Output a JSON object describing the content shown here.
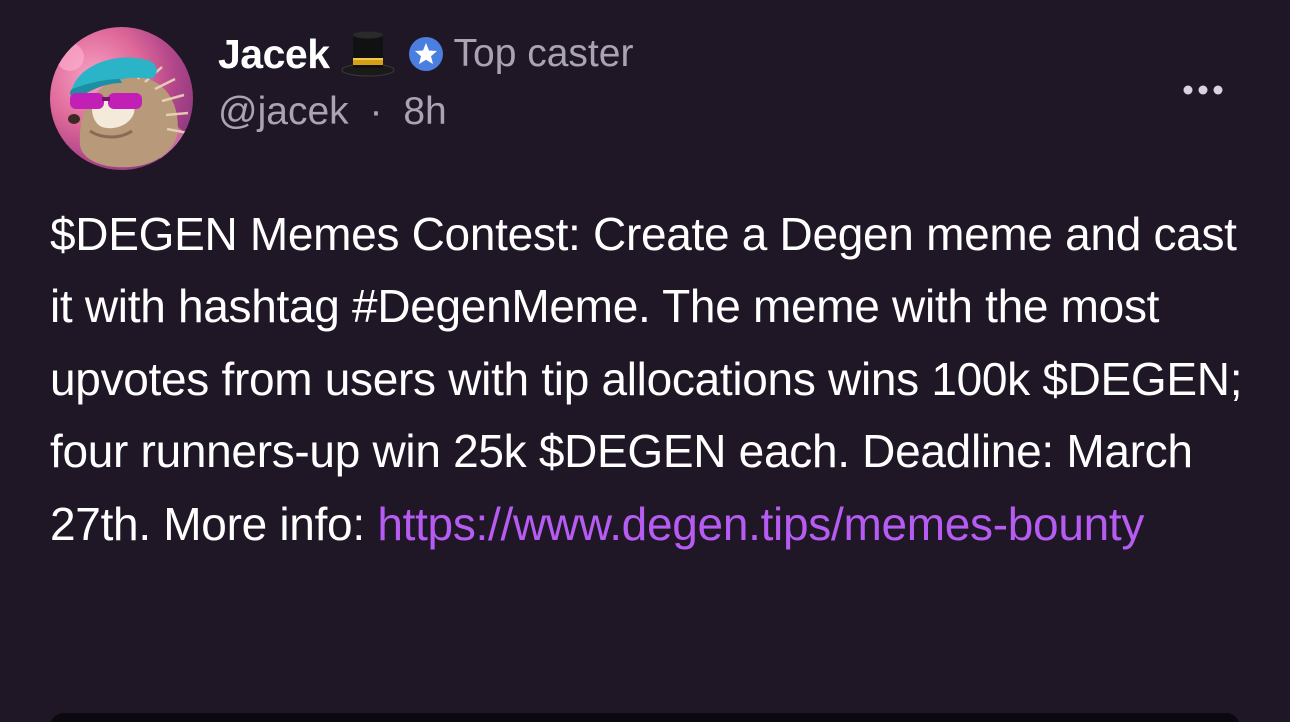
{
  "author": {
    "display_name": "Jacek",
    "handle": "@jacek",
    "separator": "·",
    "time_ago": "8h",
    "badge_label": "Top caster",
    "avatar_icon": "hedgehog-avatar",
    "hat_icon": "top-hat-icon",
    "badge_icon": "star-badge-icon"
  },
  "post": {
    "text": "$DEGEN Memes Contest: Create a Degen meme and cast it with hashtag #DegenMeme. The meme with the most upvotes from users with tip allocations wins 100k $DEGEN; four runners-up win 25k $DEGEN each. Deadline: March 27th. More info: ",
    "link_text": "https://www.degen.tips/memes-bounty"
  },
  "menu_icon": "more-options-icon",
  "colors": {
    "background": "#1f1726",
    "primary_text": "#ffffff",
    "secondary_text": "#a9a3b3",
    "link": "#b65cf2",
    "badge_blue": "#4a7fe0"
  }
}
